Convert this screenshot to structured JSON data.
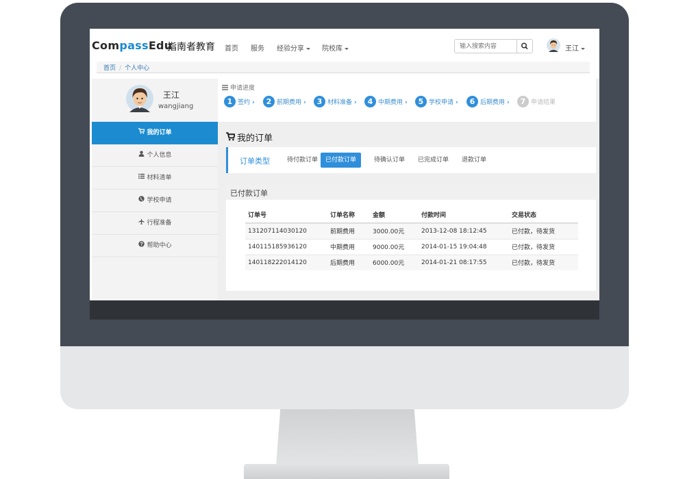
{
  "brand": {
    "name_part1": "Com",
    "name_accent": "pass",
    "name_part2": "Edu",
    "name_cn": "指南者教育"
  },
  "nav": {
    "items": [
      {
        "label": "首页"
      },
      {
        "label": "服务"
      },
      {
        "label": "经验分享"
      },
      {
        "label": "院校库"
      }
    ],
    "search_placeholder": "输入搜索内容",
    "user_name": "王江"
  },
  "breadcrumb": {
    "home": "首页",
    "separator": "/",
    "current": "个人中心"
  },
  "profile": {
    "display_name": "王江",
    "username": "wangjiang"
  },
  "sidebar": {
    "items": [
      {
        "label": "我的订单",
        "icon": "cart-icon",
        "active": true
      },
      {
        "label": "个人信息",
        "icon": "user-icon"
      },
      {
        "label": "材料清单",
        "icon": "list-icon"
      },
      {
        "label": "学校申请",
        "icon": "globe-icon"
      },
      {
        "label": "行程准备",
        "icon": "plane-icon"
      },
      {
        "label": "帮助中心",
        "icon": "help-icon"
      }
    ]
  },
  "progress": {
    "title": "申请进度",
    "steps": [
      {
        "num": "1",
        "label": "签约"
      },
      {
        "num": "2",
        "label": "前期费用"
      },
      {
        "num": "3",
        "label": "材料准备"
      },
      {
        "num": "4",
        "label": "中期费用"
      },
      {
        "num": "5",
        "label": "学校申请"
      },
      {
        "num": "6",
        "label": "后期费用"
      },
      {
        "num": "7",
        "label": "申请结果"
      }
    ]
  },
  "orders": {
    "title": "我的订单",
    "type_label": "订单类型",
    "tabs": [
      {
        "label": "待付款订单"
      },
      {
        "label": "已付款订单",
        "active": true
      },
      {
        "label": "待确认订单"
      },
      {
        "label": "已完成订单"
      },
      {
        "label": "退款订单"
      }
    ],
    "panel_title": "已付款订单",
    "table": {
      "headers": [
        "订单号",
        "订单名称",
        "金额",
        "付款时间",
        "交易状态"
      ],
      "rows": [
        [
          "131207114030120",
          "前期费用",
          "3000.00元",
          "2013-12-08 18:12:45",
          "已付款，待发货"
        ],
        [
          "140115185936120",
          "中期费用",
          "9000.00元",
          "2014-01-15 19:04:48",
          "已付款，待发货"
        ],
        [
          "140118222014120",
          "后期费用",
          "6000.00元",
          "2014-01-21 08:17:55",
          "已付款，待发货"
        ]
      ]
    }
  },
  "colors": {
    "accent": "#1c8bd0",
    "bezel": "#454b54",
    "footer": "#2f3237"
  }
}
